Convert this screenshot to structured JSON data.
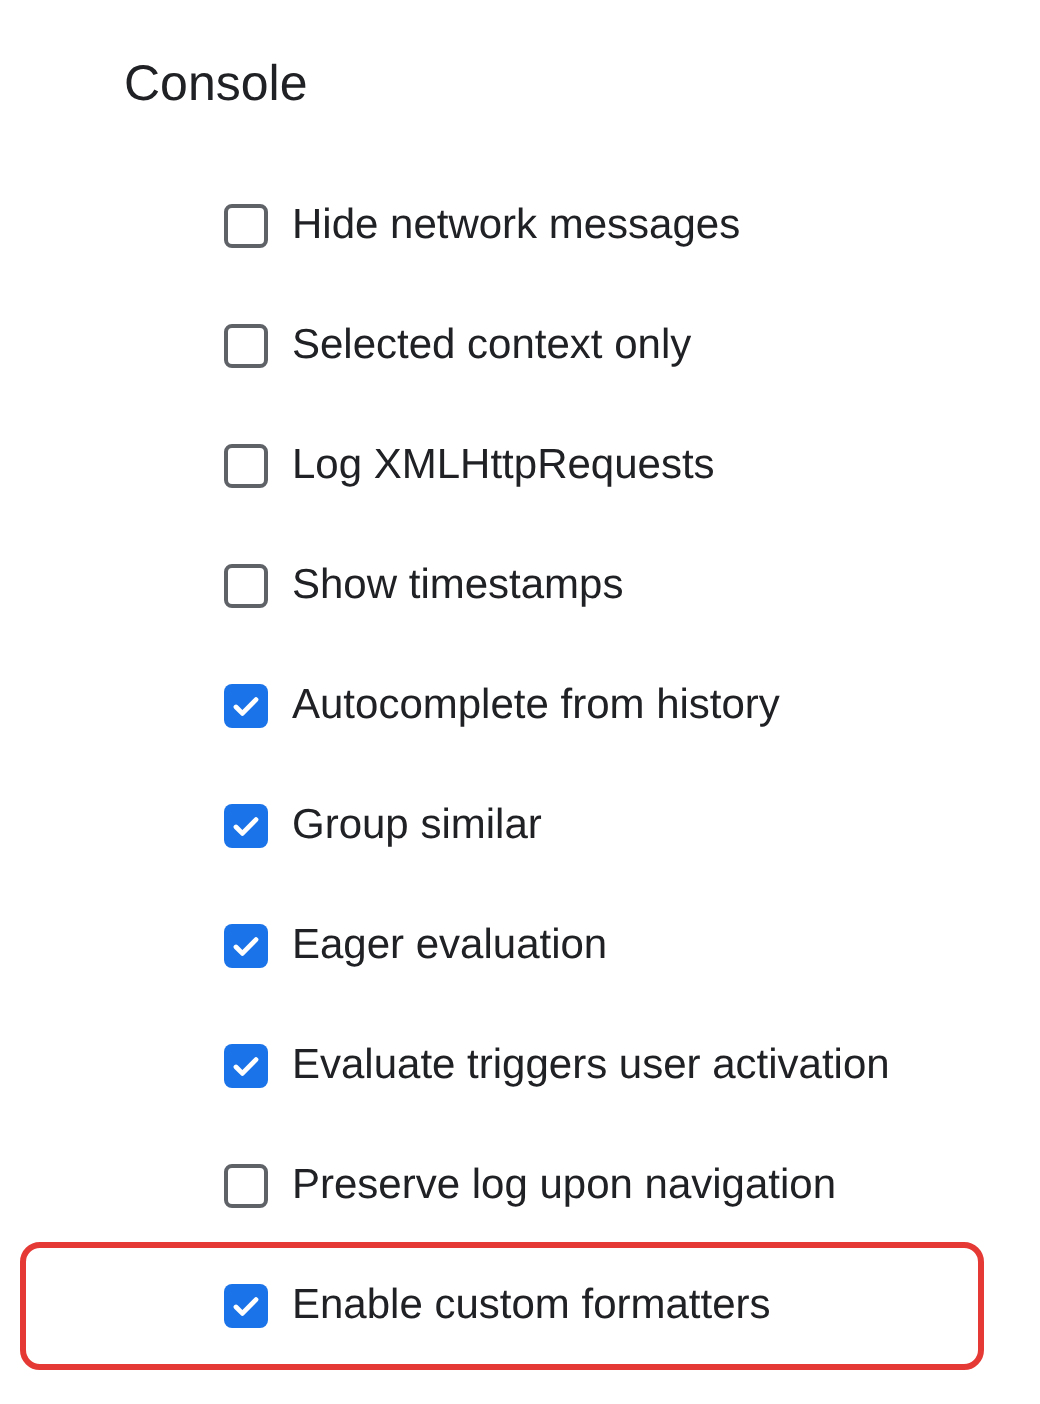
{
  "section_title": "Console",
  "options": [
    {
      "label": "Hide network messages",
      "checked": false,
      "highlighted": false
    },
    {
      "label": "Selected context only",
      "checked": false,
      "highlighted": false
    },
    {
      "label": "Log XMLHttpRequests",
      "checked": false,
      "highlighted": false
    },
    {
      "label": "Show timestamps",
      "checked": false,
      "highlighted": false
    },
    {
      "label": "Autocomplete from history",
      "checked": true,
      "highlighted": false
    },
    {
      "label": "Group similar",
      "checked": true,
      "highlighted": false
    },
    {
      "label": "Eager evaluation",
      "checked": true,
      "highlighted": false
    },
    {
      "label": "Evaluate triggers user activation",
      "checked": true,
      "highlighted": false
    },
    {
      "label": "Preserve log upon navigation",
      "checked": false,
      "highlighted": false
    },
    {
      "label": "Enable custom formatters",
      "checked": true,
      "highlighted": true
    }
  ]
}
